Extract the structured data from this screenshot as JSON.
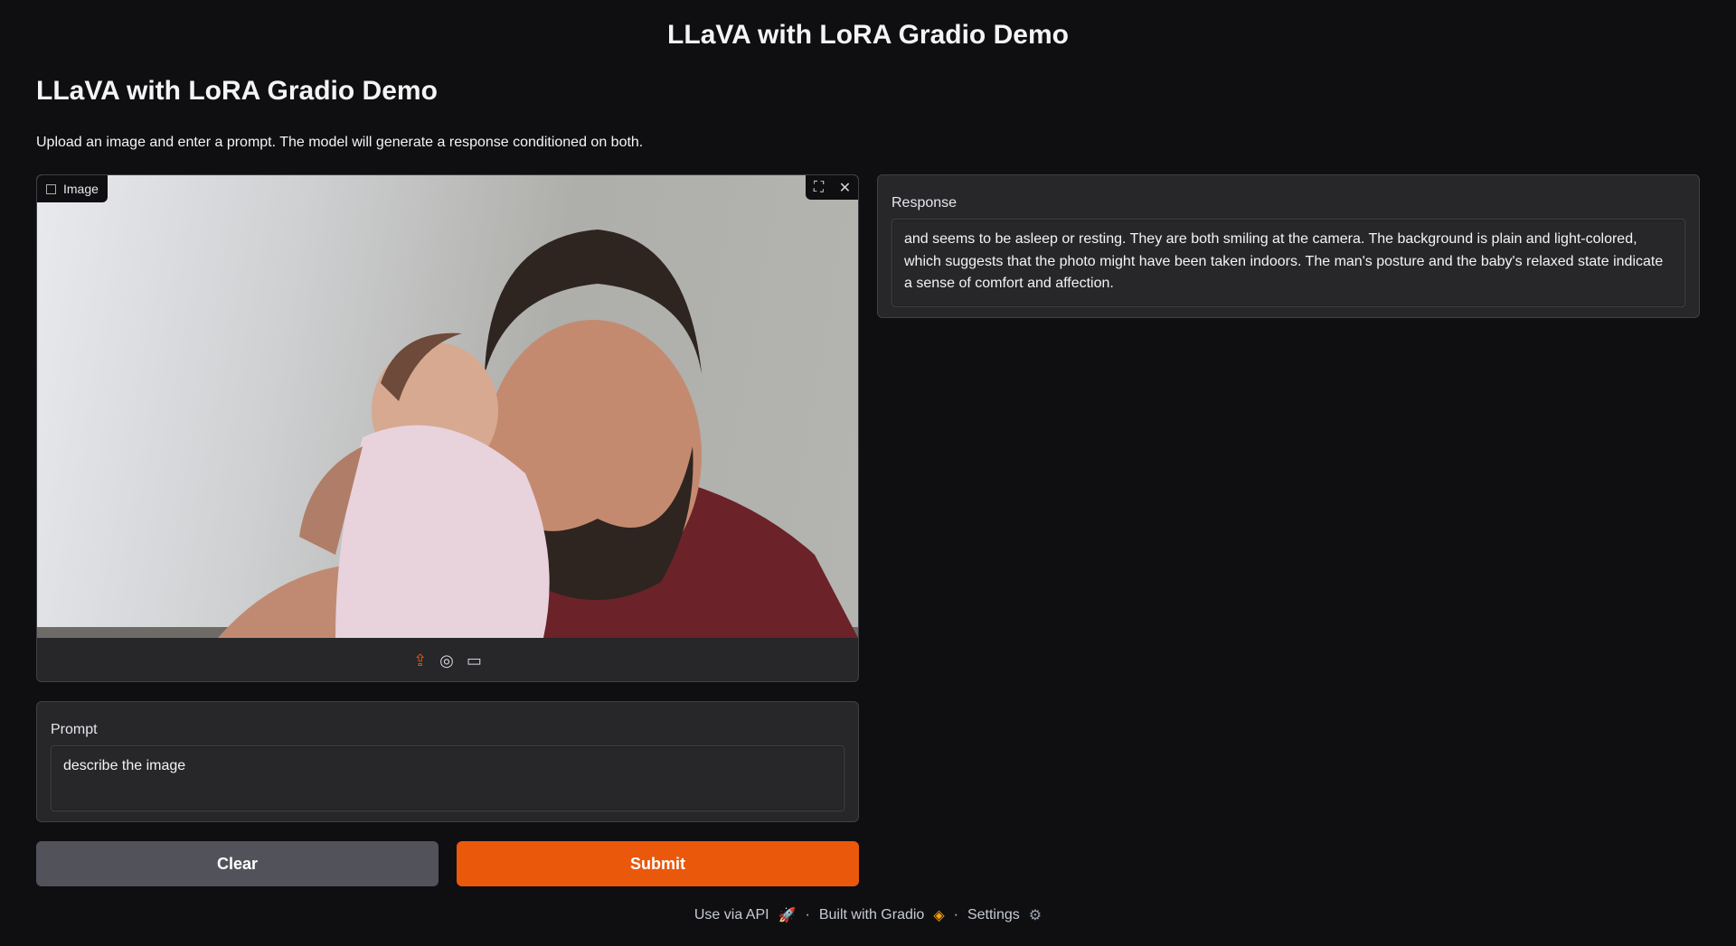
{
  "app": {
    "title": "LLaVA with LoRA Gradio Demo",
    "heading": "LLaVA with LoRA Gradio Demo",
    "description": "Upload an image and enter a prompt. The model will generate a response conditioned on both."
  },
  "image": {
    "label": "Image",
    "icons": [
      "image-icon",
      "fullscreen-icon",
      "close-icon",
      "upload-icon",
      "webcam-icon",
      "clipboard-icon"
    ]
  },
  "prompt": {
    "label": "Prompt",
    "value": "describe the image"
  },
  "response": {
    "label": "Response",
    "value": "and seems to be asleep or resting. They are both smiling at the camera. The background is plain and light-colored, which suggests that the photo might have been taken indoors. The man's posture and the baby's relaxed state indicate a sense of comfort and affection."
  },
  "buttons": {
    "clear": "Clear",
    "submit": "Submit"
  },
  "footer": {
    "api": "Use via API",
    "built": "Built with Gradio",
    "settings": "Settings",
    "sep": "·"
  },
  "colors": {
    "accent": "#ea580c",
    "background": "#0f0f11",
    "panel": "#27272a",
    "secondary_button": "#52525b"
  }
}
